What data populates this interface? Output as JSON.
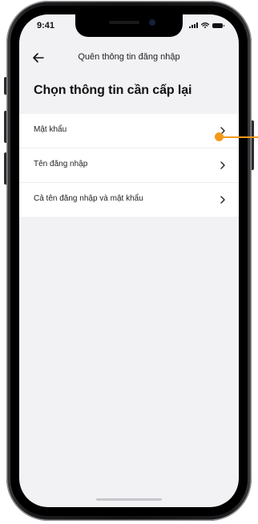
{
  "status_bar": {
    "time": "9:41"
  },
  "header": {
    "back_icon": "arrow-left-icon",
    "title": "Quên thông tin đăng nhập"
  },
  "page": {
    "title": "Chọn thông tin cần cấp lại"
  },
  "options": [
    {
      "label": "Mật khẩu",
      "icon": "chevron-right-icon"
    },
    {
      "label": "Tên đăng nhập",
      "icon": "chevron-right-icon"
    },
    {
      "label": "Cả tên đăng nhập và mật khẩu",
      "icon": "chevron-right-icon"
    }
  ],
  "colors": {
    "accent_marker": "#f39a1e",
    "screen_background": "#f2f2f5",
    "list_background": "#ffffff",
    "text": "#222222"
  }
}
